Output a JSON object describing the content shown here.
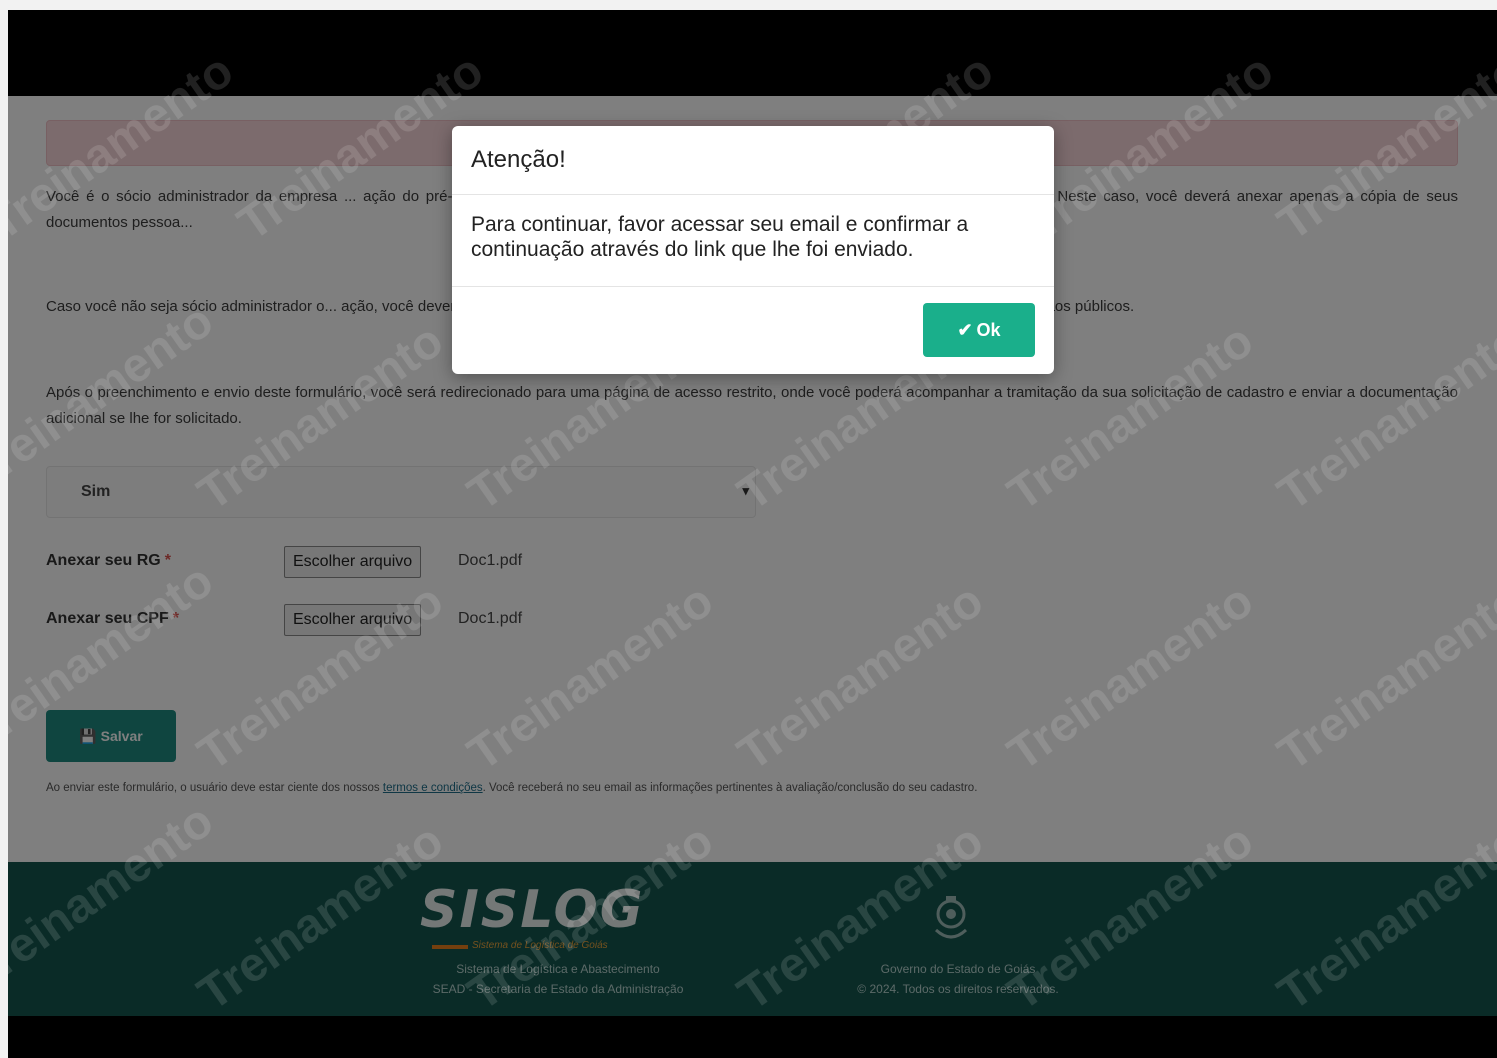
{
  "intro": {
    "paragraph_1": "Você é o sócio administrador da empresa ... ação do pré-cadastro poderá ser deferida automaticamente pelo Sistema, mediante ch... - JUCEG. Neste caso, você deverá anexar apenas a cópia de seus documentos pessoa...",
    "paragraph_2": "Caso você não seja sócio administrador o... ação, você deverá anexar, além dos seus documentos pessoais, a procuração de outo... ativa perante órgãos públicos.",
    "paragraph_3": "Após o preenchimento e envio deste formulário, você será redirecionado para uma página de acesso restrito, onde você poderá acompanhar a tramitação da sua solicitação de cadastro e enviar a documentação adicional se lhe for solicitado."
  },
  "form": {
    "select_value": "Sim",
    "rg_label": "Anexar seu RG",
    "cpf_label": "Anexar seu CPF",
    "required_mark": "*",
    "file_button_label": "Escolher arquivo",
    "rg_file": "Doc1.pdf",
    "cpf_file": "Doc1.pdf",
    "save_label": "Salvar",
    "disclaimer_before": "Ao enviar este formulário, o usuário deve estar ciente dos nossos",
    "disclaimer_link": "termos e condições",
    "disclaimer_after": ". Você receberá no seu email as informações pertinentes à avaliação/conclusão do seu cadastro."
  },
  "footer": {
    "brand": "SISLOG",
    "brand_tagline": "Sistema de Logística de Goiás",
    "left_line_1": "Sistema de Logística e Abastecimento",
    "left_line_2": "SEAD - Secretaria de Estado da Administração",
    "right_line_1": "Governo do Estado de Goiás",
    "right_line_2": "© 2024. Todos os direitos reservados."
  },
  "watermark_text": "Treinamento",
  "modal": {
    "title": "Atenção!",
    "message": "Para continuar, favor acessar seu email e confirmar a continuação através do link que lhe foi enviado.",
    "ok_label": "Ok"
  },
  "colors": {
    "accent": "#1aaf8b",
    "footer_bg": "#15564f",
    "save_button": "#1f8a80"
  }
}
